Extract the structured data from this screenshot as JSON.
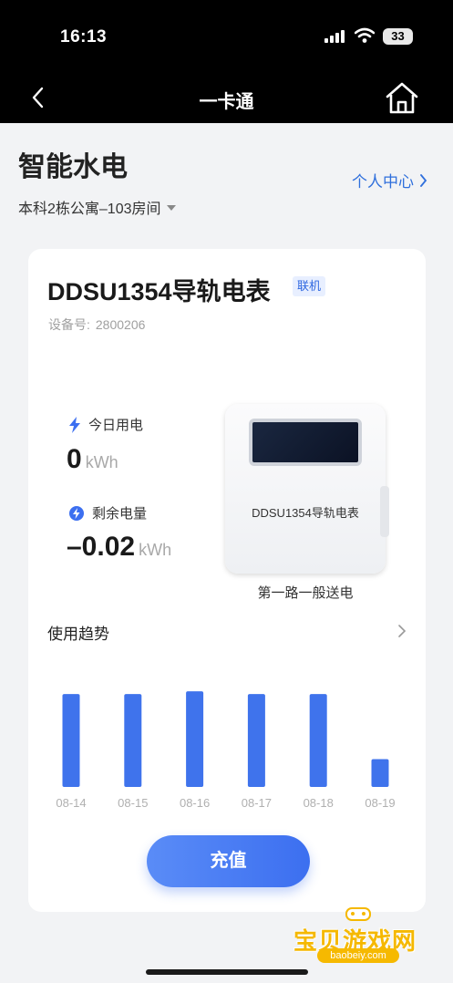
{
  "status_bar": {
    "time": "16:13",
    "battery": "33"
  },
  "nav": {
    "title": "一卡通",
    "back_icon": "chevron-left-icon",
    "home_icon": "home-icon"
  },
  "header": {
    "title": "智能水电",
    "personal_center": "个人中心",
    "room": "本科2栋公寓–103房间"
  },
  "device": {
    "name": "DDSU1354导轨电表",
    "status_badge": "联机",
    "id_label": "设备号:",
    "id_value": "2800206"
  },
  "metrics": {
    "today": {
      "label": "今日用电",
      "value": "0",
      "unit": "kWh"
    },
    "remaining": {
      "label": "剩余电量",
      "value": "–0.02",
      "unit": "kWh"
    }
  },
  "meter": {
    "label": "DDSU1354导轨电表",
    "caption": "第一路一般送电"
  },
  "trend": {
    "title": "使用趋势"
  },
  "chart_data": {
    "type": "bar",
    "categories": [
      "08-14",
      "08-15",
      "08-16",
      "08-17",
      "08-18",
      "08-19"
    ],
    "values": [
      1.0,
      1.0,
      1.03,
      1.0,
      1.0,
      0.3
    ],
    "bar_color": "#3f73ec",
    "ylim": [
      0,
      1.1
    ],
    "grid": false
  },
  "actions": {
    "recharge": "充值"
  },
  "watermark": {
    "text": "宝贝游戏网",
    "url": "baobeiy.com"
  },
  "colors": {
    "accent": "#3c6ff0",
    "link": "#2f6fdc",
    "badge_bg": "#e8efff"
  }
}
